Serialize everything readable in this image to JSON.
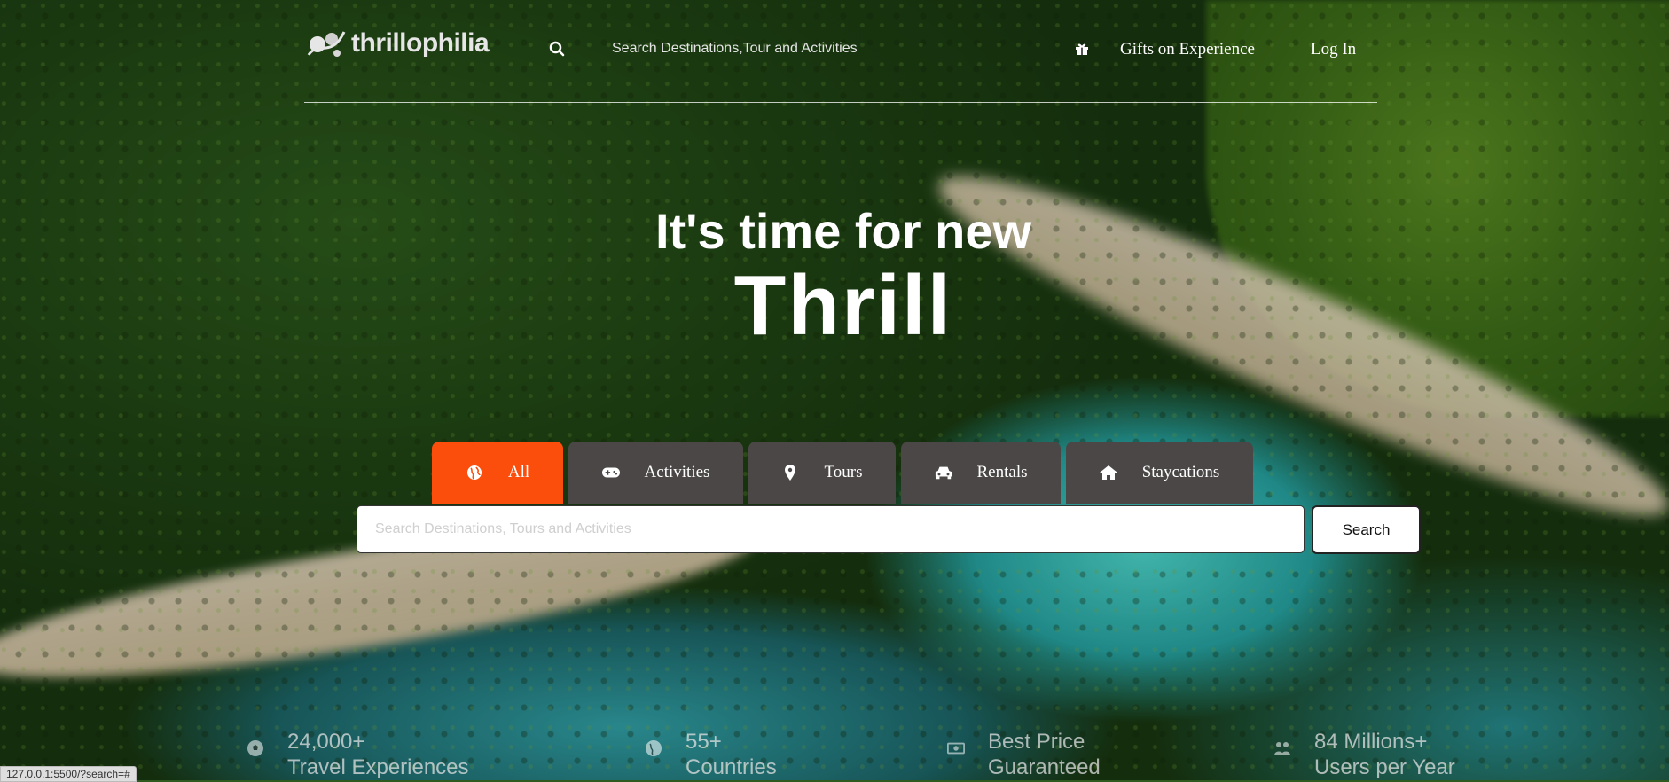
{
  "header": {
    "logo_text": "thrillophilia",
    "search_placeholder": "Search Destinations,Tour and Activities",
    "gifts_label": "Gifts on Experience",
    "login_label": "Log In"
  },
  "hero": {
    "line1": "It's time for new",
    "line2": "Thrill"
  },
  "tabs": [
    {
      "label": "All",
      "icon": "globe-icon",
      "active": true
    },
    {
      "label": "Activities",
      "icon": "gamepad-icon",
      "active": false
    },
    {
      "label": "Tours",
      "icon": "map-pin-icon",
      "active": false
    },
    {
      "label": "Rentals",
      "icon": "car-icon",
      "active": false
    },
    {
      "label": "Staycations",
      "icon": "home-icon",
      "active": false
    }
  ],
  "search": {
    "placeholder": "Search Destinations, Tours and Activities",
    "value": "",
    "button_label": "Search"
  },
  "stats": [
    {
      "title": "24,000+",
      "subtitle": "Travel Experiences",
      "icon": "soccer-ball-icon"
    },
    {
      "title": "55+",
      "subtitle": "Countries",
      "icon": "globe-icon"
    },
    {
      "title": "Best Price",
      "subtitle": "Guaranteed",
      "icon": "money-icon"
    },
    {
      "title": "84 Millions+",
      "subtitle": "Users per Year",
      "icon": "users-icon"
    }
  ],
  "status_bar": {
    "url": "127.0.0.1:5500/?search=#"
  },
  "colors": {
    "accent": "#fb4d0c",
    "tab_bg": "#4a4746"
  }
}
